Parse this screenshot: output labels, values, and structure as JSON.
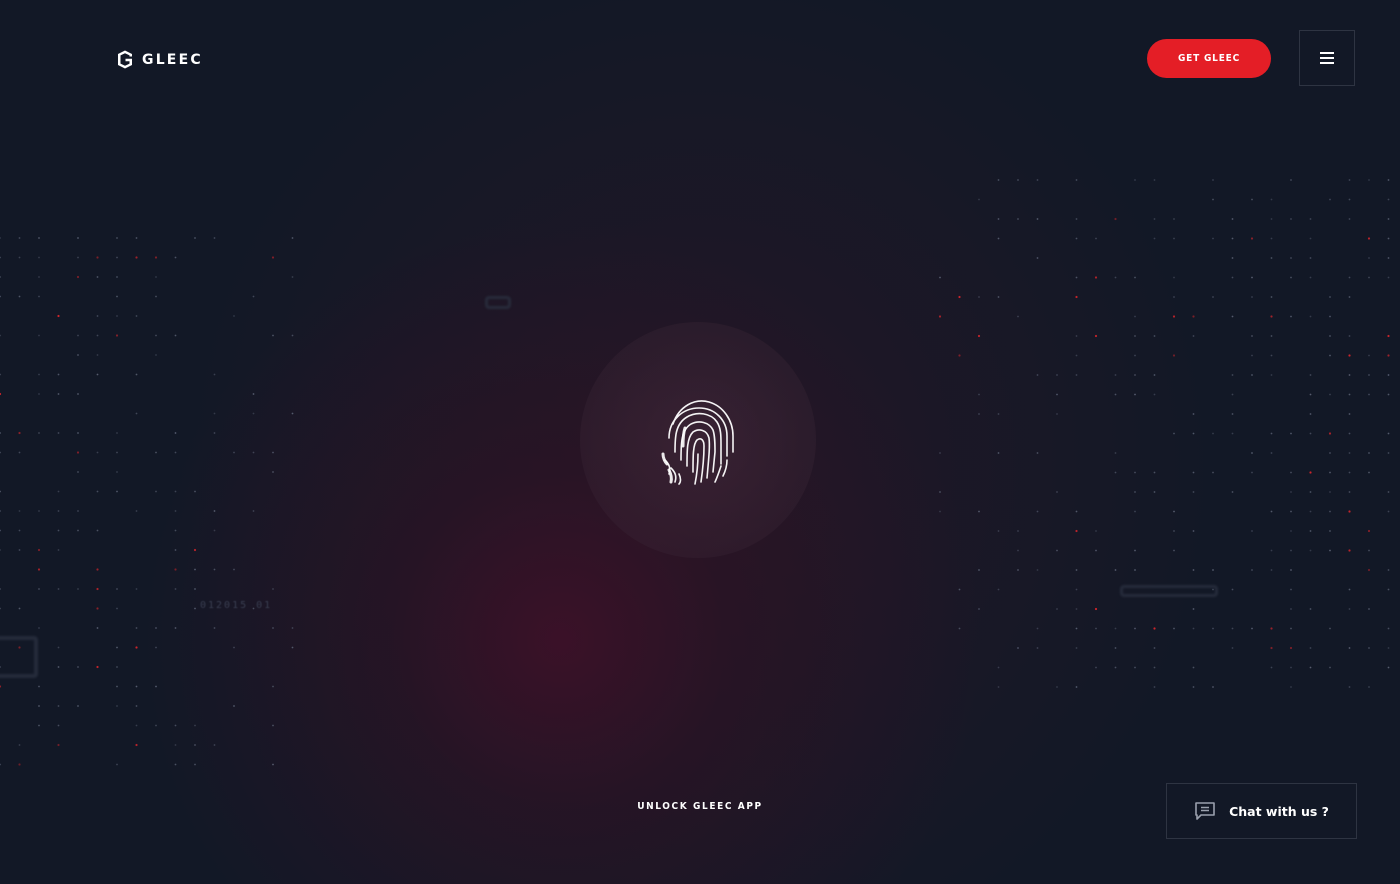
{
  "brand": {
    "name": "GLEEC",
    "logo_icon": "gleec-g-logo",
    "accent_color": "#e41e26",
    "background_color": "#121826"
  },
  "header": {
    "cta_label": "GET GLEEC",
    "menu_icon": "hamburger-menu-icon"
  },
  "hero": {
    "icon": "fingerprint-icon",
    "unlock_label": "UNLOCK GLEEC APP",
    "decor_code": "012015 01"
  },
  "chat": {
    "icon": "chat-bubble-icon",
    "label": "Chat with us ?"
  }
}
